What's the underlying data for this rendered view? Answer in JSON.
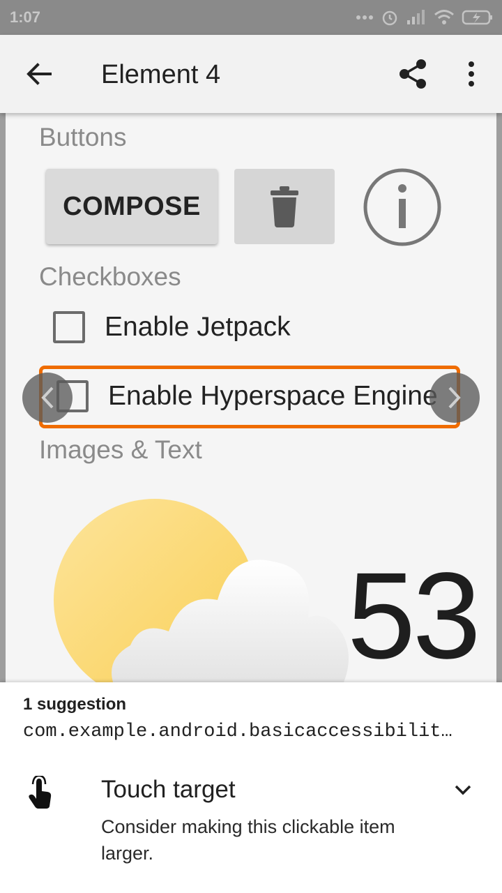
{
  "status_bar": {
    "time": "1:07",
    "icons": [
      "more-dots-icon",
      "alarm-icon",
      "signal-icon",
      "wifi-icon",
      "battery-icon"
    ]
  },
  "app_bar": {
    "title": "Element 4",
    "icons": [
      "back-arrow-icon",
      "share-icon",
      "more-vert-icon"
    ]
  },
  "sections": {
    "buttons_title": "Buttons",
    "checkboxes_title": "Checkboxes",
    "images_title": "Images & Text"
  },
  "buttons": {
    "compose_label": "COMPOSE",
    "trash_icon": "trash-icon",
    "info_icon": "info-icon"
  },
  "checkboxes": [
    {
      "label": "Enable Jetpack",
      "checked": false
    },
    {
      "label": "Enable Hyperspace Engine",
      "checked": false
    }
  ],
  "weather": {
    "icon": "sun-cloud-icon",
    "temperature": "53"
  },
  "colors": {
    "highlight": "#ef6c00",
    "sun": "#fcd96a"
  },
  "suggestions": {
    "count_label": "1 suggestion",
    "package": "com.example.android.basicaccessibilit…",
    "item": {
      "icon": "touch-hand-icon",
      "title": "Touch target",
      "description": "Consider making this clickable item larger."
    }
  }
}
